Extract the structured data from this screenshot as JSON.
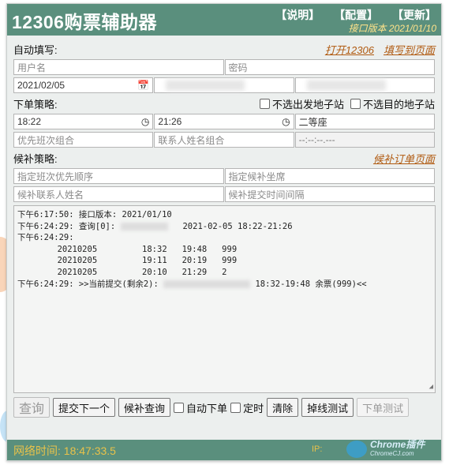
{
  "app": {
    "title": "12306购票辅助器",
    "links": [
      "【说明】",
      "【配置】",
      "【更新】"
    ],
    "version": "接口版本 2021/01/10"
  },
  "autofill": {
    "label": "自动填写:",
    "open_link": "打开12306",
    "fill_link": "填写到页面",
    "username_placeholder": "用户名",
    "password_placeholder": "密码",
    "date": "2021/02/05"
  },
  "strategy": {
    "label": "下单策略:",
    "no_sub_from": "不选出发地子站",
    "no_sub_to": "不选目的地子站",
    "time_start": "18:22",
    "time_end": "21:26",
    "seat": "二等座",
    "train_combo_placeholder": "优先班次组合",
    "contact_combo_placeholder": "联系人姓名组合",
    "time_disabled": "--:--:--.---"
  },
  "waitlist": {
    "label": "候补策略:",
    "order_link": "候补订单页面",
    "train_order_placeholder": "指定班次优先顺序",
    "seat_placeholder": "指定候补坐席",
    "contact_placeholder": "候补联系人姓名",
    "interval_placeholder": "候补提交时间间隔"
  },
  "log": {
    "lines": [
      "下午6:17:50: 接口版本: 2021/01/10",
      "下午6:24:29: 查询[0]:",
      "2021-02-05 18:22-21:26",
      "下午6:24:29:",
      "        20210205         18:32   19:48   999",
      "        20210205         19:11   20:19   999",
      "        20210205         20:10   21:29   2",
      "下午6:24:29: >>当前提交(剩余2):",
      "18:32-19:48 余票(999)<<"
    ]
  },
  "buttons": {
    "query": "查询",
    "submit_next": "提交下一个",
    "waitlist_query": "候补查询",
    "auto_order": "自动下单",
    "timer": "定时",
    "clear": "清除",
    "disconnect_test": "掉线测试",
    "order_test": "下单测试"
  },
  "footer": {
    "network_time": "网络时间: 18:47:33.5",
    "ip_label": "IP:",
    "watermark": "Chrome插件",
    "watermark_sub": "ChromeCJ.com"
  }
}
